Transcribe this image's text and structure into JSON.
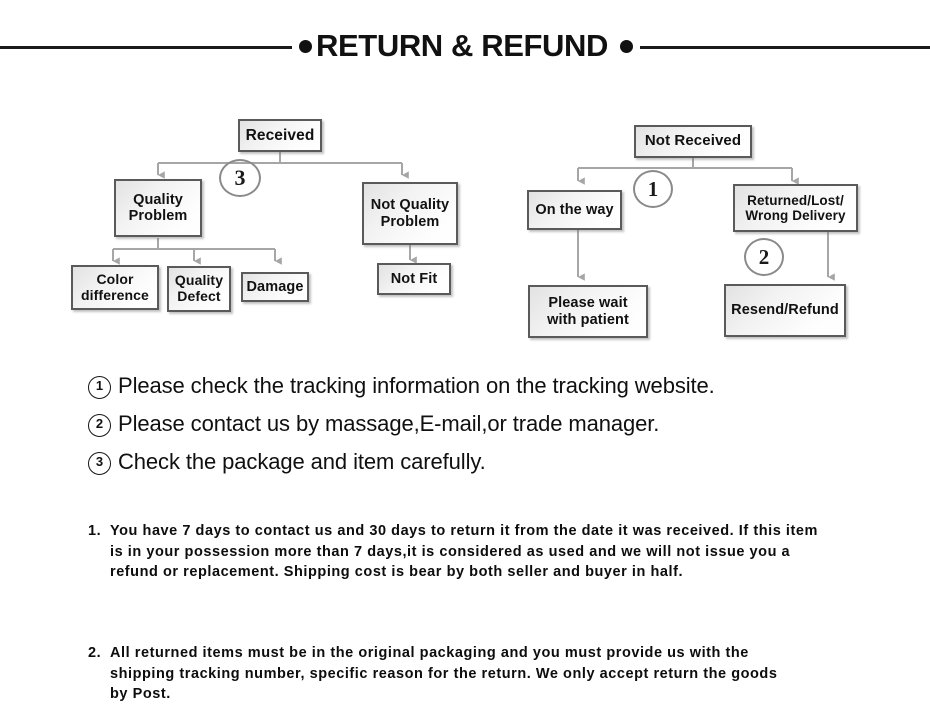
{
  "header": {
    "title": "RETURN & REFUND",
    "left_dot": "bullet-dot",
    "right_dot": "bullet-dot"
  },
  "flowchart": {
    "left_tree": {
      "root": "Received",
      "marker": "3",
      "branches": [
        {
          "label": "Quality\nProblem",
          "children": [
            "Color\ndifference",
            "Quality\nDefect",
            "Damage"
          ]
        },
        {
          "label": "Not Quality\nProblem",
          "children": [
            "Not Fit"
          ]
        }
      ]
    },
    "right_tree": {
      "root": "Not  Received",
      "marker_top": "1",
      "marker_mid": "2",
      "branches": [
        {
          "label": "On the way",
          "children": [
            "Please wait\nwith patient"
          ]
        },
        {
          "label": "Returned/Lost/\nWrong Delivery",
          "children": [
            "Resend/Refund"
          ]
        }
      ]
    },
    "nodes": {
      "received": "Received",
      "quality_problem_l1": "Quality",
      "quality_problem_l2": "Problem",
      "not_quality_problem_l1": "Not Quality",
      "not_quality_problem_l2": "Problem",
      "color_difference_l1": "Color",
      "color_difference_l2": "difference",
      "quality_defect_l1": "Quality",
      "quality_defect_l2": "Defect",
      "damage": "Damage",
      "not_fit": "Not Fit",
      "not_received": "Not  Received",
      "on_the_way": "On the way",
      "returned_lost_l1": "Returned/Lost/",
      "returned_lost_l2": "Wrong Delivery",
      "please_wait_l1": "Please wait",
      "please_wait_l2": "with patient",
      "resend_refund": "Resend/Refund"
    },
    "markers": {
      "three": "3",
      "one": "1",
      "two": "2"
    }
  },
  "notes": [
    {
      "num": "1",
      "text": "Please check the tracking information on the tracking website."
    },
    {
      "num": "2",
      "text": "Please contact us by  massage,E-mail,or trade manager."
    },
    {
      "num": "3",
      "text": "Check the package and item carefully."
    }
  ],
  "terms": [
    {
      "num": "1.",
      "text": "You have 7 days to contact us and 30 days to return it from the date it was received. If this item is in your possession more than 7 days,it is considered as used and we will not issue you a refund or replacement. Shipping cost is bear by both seller and buyer in half."
    },
    {
      "num": "2.",
      "text": "All returned items must be in the original packaging and you must provide us with the shipping tracking number, specific reason for the return. We only accept return the goods by Post."
    }
  ],
  "colors": {
    "text": "#111111",
    "rule": "#1a1a1a",
    "node_border": "#5a5a5a",
    "connector": "#9a9a9a",
    "circle_border": "#8a8a8a"
  }
}
